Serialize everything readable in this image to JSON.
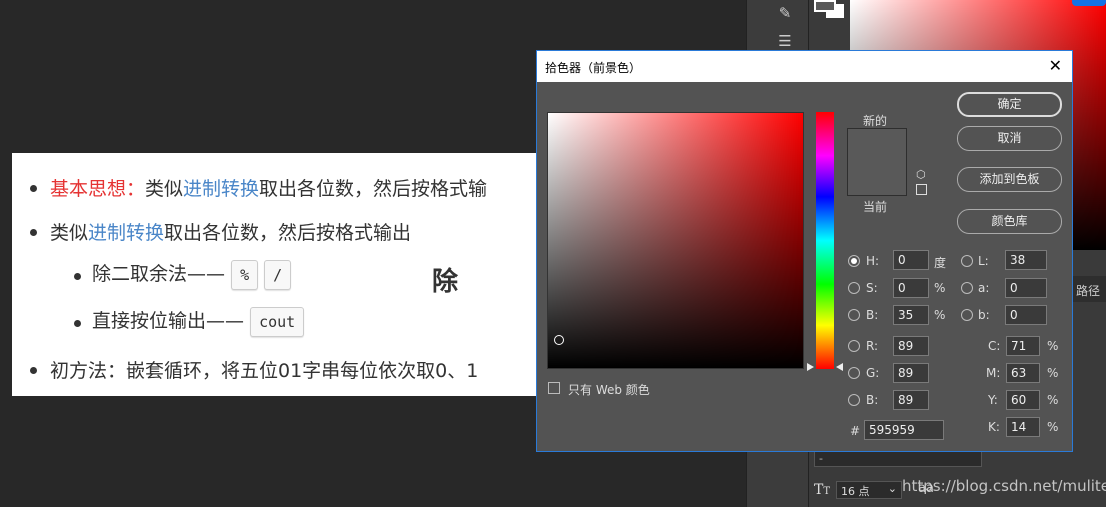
{
  "article": {
    "li1_label": "基本思想：",
    "li1_pre": "类似",
    "li1_link": "进制转换",
    "li1_post": "取出各位数，然后按格式输",
    "li2_pre": "类似",
    "li2_link": "进制转换",
    "li2_post": "取出各位数，然后按格式输出",
    "sub1_text": "除二取余法——",
    "sub1_code1": "%",
    "sub1_code2": "/",
    "sub1_big": "除",
    "sub2_text": "直接按位输出——",
    "sub2_code": "cout",
    "li3_text": "初方法：嵌套循环，将五位01字串每位依次取0、1"
  },
  "dialog": {
    "title": "拾色器（前景色）",
    "new_label": "新的",
    "current_label": "当前",
    "ok": "确定",
    "cancel": "取消",
    "add_swatch": "添加到色板",
    "color_library": "颜色库",
    "web_only": "只有 Web 颜色",
    "fields": {
      "H": {
        "label": "H:",
        "value": "0",
        "unit": "度"
      },
      "S": {
        "label": "S:",
        "value": "0",
        "unit": "%"
      },
      "Bright": {
        "label": "B:",
        "value": "35",
        "unit": "%"
      },
      "R": {
        "label": "R:",
        "value": "89"
      },
      "G": {
        "label": "G:",
        "value": "89"
      },
      "Blue": {
        "label": "B:",
        "value": "89"
      },
      "L": {
        "label": "L:",
        "value": "38"
      },
      "a": {
        "label": "a:",
        "value": "0"
      },
      "b": {
        "label": "b:",
        "value": "0"
      },
      "C": {
        "label": "C:",
        "value": "71",
        "unit": "%"
      },
      "M": {
        "label": "M:",
        "value": "63",
        "unit": "%"
      },
      "Y": {
        "label": "Y:",
        "value": "60",
        "unit": "%"
      },
      "K": {
        "label": "K:",
        "value": "14",
        "unit": "%"
      }
    },
    "hex_label": "#",
    "hex_value": "595959",
    "selected_color": "#595959"
  },
  "ps": {
    "tab_path": "路径",
    "font_size": "16 点",
    "dropdown": "-",
    "aa": "aa",
    "text_tool": "T"
  },
  "watermark": "https://blog.csdn.net/muliter"
}
